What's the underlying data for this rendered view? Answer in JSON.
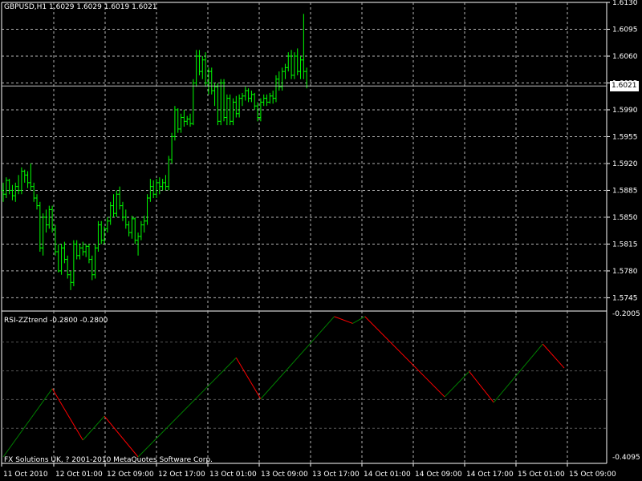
{
  "window": {
    "price_header": "GBPUSD,H1  1.6029 1.6029 1.6019 1.6021",
    "indicator_header": "RSI-ZZtrend -0.2800 -0.2800",
    "copyright": "FX Solutions UK, ? 2001-2010 MetaQuotes Software Corp.",
    "current_price_label": "1.6021"
  },
  "colors": {
    "background": "#000000",
    "grid": "#b4b4b4",
    "candle": "#00ff00",
    "zigzag_up": "#008000",
    "zigzag_down": "#ff0000",
    "text": "#ffffff"
  },
  "chart_data": [
    {
      "type": "bar",
      "subtype": "ohlc",
      "symbol": "GBPUSD",
      "timeframe": "H1",
      "grid": true,
      "ylim": [
        1.5735,
        1.613
      ],
      "y_ticks": [
        "1.6130",
        "1.6095",
        "1.6060",
        "1.6025",
        "1.5990",
        "1.5955",
        "1.5920",
        "1.5885",
        "1.5850",
        "1.5815",
        "1.5780",
        "1.5745"
      ],
      "x_ticks": [
        "11 Oct 2010",
        "12 Oct 01:00",
        "12 Oct 09:00",
        "12 Oct 17:00",
        "13 Oct 01:00",
        "13 Oct 09:00",
        "13 Oct 17:00",
        "14 Oct 01:00",
        "14 Oct 09:00",
        "14 Oct 17:00",
        "15 Oct 01:00",
        "15 Oct 09:00"
      ],
      "last_price": 1.6021,
      "bars": [
        [
          1.5885,
          1.5895,
          1.587,
          1.588
        ],
        [
          1.588,
          1.5902,
          1.5875,
          1.5898
        ],
        [
          1.5898,
          1.59,
          1.588,
          1.5885
        ],
        [
          1.5885,
          1.5892,
          1.5872,
          1.5878
        ],
        [
          1.5878,
          1.5895,
          1.587,
          1.589
        ],
        [
          1.589,
          1.5905,
          1.588,
          1.5885
        ],
        [
          1.5885,
          1.5915,
          1.588,
          1.591
        ],
        [
          1.591,
          1.5912,
          1.5895,
          1.5905
        ],
        [
          1.5905,
          1.591,
          1.5888,
          1.5895
        ],
        [
          1.5895,
          1.592,
          1.5885,
          1.589
        ],
        [
          1.589,
          1.5895,
          1.587,
          1.5875
        ],
        [
          1.5875,
          1.588,
          1.586,
          1.5865
        ],
        [
          1.5865,
          1.587,
          1.5805,
          1.581
        ],
        [
          1.581,
          1.5855,
          1.58,
          1.585
        ],
        [
          1.585,
          1.586,
          1.583,
          1.584
        ],
        [
          1.584,
          1.5865,
          1.5835,
          1.586
        ],
        [
          1.586,
          1.5865,
          1.583,
          1.5835
        ],
        [
          1.5835,
          1.584,
          1.58,
          1.5805
        ],
        [
          1.5805,
          1.5815,
          1.5778,
          1.578
        ],
        [
          1.578,
          1.5815,
          1.5775,
          1.581
        ],
        [
          1.581,
          1.5818,
          1.579,
          1.5795
        ],
        [
          1.5795,
          1.58,
          1.577,
          1.5775
        ],
        [
          1.5775,
          1.578,
          1.5755,
          1.5765
        ],
        [
          1.5765,
          1.582,
          1.576,
          1.5815
        ],
        [
          1.5815,
          1.582,
          1.5795,
          1.58
        ],
        [
          1.58,
          1.5815,
          1.5795,
          1.581
        ],
        [
          1.581,
          1.5818,
          1.58,
          1.5805
        ],
        [
          1.5805,
          1.5815,
          1.5798,
          1.5812
        ],
        [
          1.5812,
          1.5815,
          1.579,
          1.5795
        ],
        [
          1.5795,
          1.58,
          1.5768,
          1.5775
        ],
        [
          1.5775,
          1.5815,
          1.577,
          1.581
        ],
        [
          1.581,
          1.5845,
          1.5805,
          1.584
        ],
        [
          1.584,
          1.5845,
          1.5815,
          1.582
        ],
        [
          1.582,
          1.5838,
          1.5815,
          1.5835
        ],
        [
          1.5835,
          1.585,
          1.583,
          1.5845
        ],
        [
          1.5845,
          1.587,
          1.584,
          1.5865
        ],
        [
          1.5865,
          1.588,
          1.585,
          1.5855
        ],
        [
          1.5855,
          1.5885,
          1.585,
          1.588
        ],
        [
          1.588,
          1.589,
          1.586,
          1.5865
        ],
        [
          1.5865,
          1.587,
          1.5845,
          1.585
        ],
        [
          1.585,
          1.586,
          1.5835,
          1.584
        ],
        [
          1.584,
          1.5845,
          1.5825,
          1.583
        ],
        [
          1.583,
          1.5852,
          1.5822,
          1.5848
        ],
        [
          1.5848,
          1.585,
          1.5815,
          1.582
        ],
        [
          1.582,
          1.583,
          1.58,
          1.5825
        ],
        [
          1.5825,
          1.5845,
          1.582,
          1.584
        ],
        [
          1.584,
          1.5852,
          1.583,
          1.5845
        ],
        [
          1.5845,
          1.588,
          1.584,
          1.5875
        ],
        [
          1.5875,
          1.59,
          1.587,
          1.589
        ],
        [
          1.589,
          1.5898,
          1.5875,
          1.588
        ],
        [
          1.588,
          1.59,
          1.5875,
          1.5895
        ],
        [
          1.5895,
          1.5902,
          1.588,
          1.589
        ],
        [
          1.589,
          1.59,
          1.5885,
          1.5895
        ],
        [
          1.5895,
          1.5905,
          1.5885,
          1.589
        ],
        [
          1.589,
          1.593,
          1.5885,
          1.5925
        ],
        [
          1.5925,
          1.596,
          1.592,
          1.5955
        ],
        [
          1.5955,
          1.5995,
          1.595,
          1.599
        ],
        [
          1.599,
          1.5992,
          1.596,
          1.5965
        ],
        [
          1.5965,
          1.5985,
          1.596,
          1.598
        ],
        [
          1.598,
          1.599,
          1.5968,
          1.5975
        ],
        [
          1.5975,
          1.5982,
          1.597,
          1.5978
        ],
        [
          1.5978,
          1.5985,
          1.5968,
          1.5972
        ],
        [
          1.5972,
          1.603,
          1.597,
          1.6025
        ],
        [
          1.6025,
          1.6068,
          1.602,
          1.606
        ],
        [
          1.606,
          1.6068,
          1.6035,
          1.604
        ],
        [
          1.604,
          1.606,
          1.603,
          1.6055
        ],
        [
          1.6055,
          1.6065,
          1.602,
          1.6025
        ],
        [
          1.6025,
          1.6045,
          1.601,
          1.604
        ],
        [
          1.604,
          1.6045,
          1.601,
          1.6015
        ],
        [
          1.6015,
          1.6025,
          1.5995,
          1.602
        ],
        [
          1.602,
          1.6025,
          1.597,
          1.5975
        ],
        [
          1.5975,
          1.603,
          1.597,
          1.6025
        ],
        [
          1.6025,
          1.603,
          1.5975,
          1.598
        ],
        [
          1.598,
          1.601,
          1.597,
          1.6005
        ],
        [
          1.6005,
          1.601,
          1.597,
          1.5975
        ],
        [
          1.5975,
          1.6005,
          1.597,
          1.6
        ],
        [
          1.6,
          1.6008,
          1.598,
          1.5985
        ],
        [
          1.5985,
          1.601,
          1.598,
          1.6005
        ],
        [
          1.6005,
          1.6012,
          1.5995,
          1.6008
        ],
        [
          1.6008,
          1.602,
          1.6002,
          1.6015
        ],
        [
          1.6015,
          1.6018,
          1.6,
          1.6005
        ],
        [
          1.6005,
          1.6015,
          1.6,
          1.601
        ],
        [
          1.601,
          1.6012,
          1.599,
          1.5995
        ],
        [
          1.5995,
          1.6,
          1.5975,
          1.598
        ],
        [
          1.598,
          1.6005,
          1.5975,
          1.6
        ],
        [
          1.6,
          1.601,
          1.5995,
          1.6005
        ],
        [
          1.6005,
          1.601,
          1.5995,
          1.6
        ],
        [
          1.6,
          1.6012,
          1.5998,
          1.6008
        ],
        [
          1.6008,
          1.6015,
          1.5998,
          1.6005
        ],
        [
          1.6005,
          1.6035,
          1.6,
          1.603
        ],
        [
          1.603,
          1.604,
          1.6015,
          1.602
        ],
        [
          1.602,
          1.6045,
          1.6015,
          1.604
        ],
        [
          1.604,
          1.605,
          1.603,
          1.6045
        ],
        [
          1.6045,
          1.6065,
          1.604,
          1.606
        ],
        [
          1.606,
          1.6068,
          1.603,
          1.6035
        ],
        [
          1.6035,
          1.6065,
          1.603,
          1.606
        ],
        [
          1.606,
          1.607,
          1.6035,
          1.604
        ],
        [
          1.604,
          1.606,
          1.603,
          1.6055
        ],
        [
          1.6055,
          1.6115,
          1.603,
          1.604
        ],
        [
          1.604,
          1.6045,
          1.6018,
          1.6021
        ]
      ]
    },
    {
      "type": "line",
      "name": "RSI-ZZtrend",
      "grid": true,
      "ylim": [
        -0.4095,
        -0.2005
      ],
      "y_ticks": [
        "-0.2005",
        "-0.4095"
      ],
      "points": [
        [
          0,
          -0.4095
        ],
        [
          16,
          -0.31
        ],
        [
          26,
          -0.385
        ],
        [
          33,
          -0.35
        ],
        [
          44,
          -0.4095
        ],
        [
          76,
          -0.265
        ],
        [
          84,
          -0.325
        ],
        [
          108,
          -0.205
        ],
        [
          114,
          -0.215
        ],
        [
          118,
          -0.205
        ],
        [
          144,
          -0.322
        ],
        [
          152,
          -0.285
        ],
        [
          160,
          -0.33
        ],
        [
          176,
          -0.245
        ],
        [
          183,
          -0.28
        ]
      ],
      "segment_colors": [
        "up",
        "down",
        "up",
        "down",
        "up",
        "down",
        "up",
        "down",
        "up",
        "down",
        "up",
        "down",
        "up",
        "down"
      ]
    }
  ]
}
